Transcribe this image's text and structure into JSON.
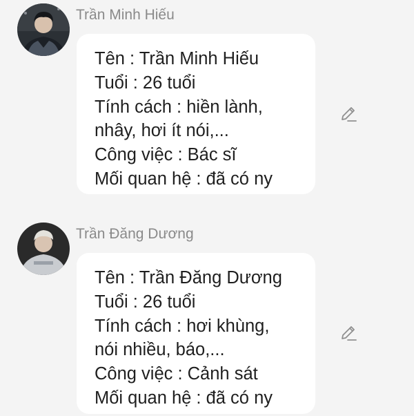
{
  "messages": [
    {
      "sender": "Trần Minh Hiếu",
      "avatar_icon": "profile-photo",
      "lines": [
        "Tên : Trần Minh Hiếu",
        "Tuổi : 26 tuổi",
        "Tính cách : hiền lành,",
        "nhây, hơi ít nói,...",
        "Công việc : Bác sĩ",
        "Mối quan hệ : đã có ny"
      ],
      "action_icon": "edit-icon"
    },
    {
      "sender": "Trần Đăng Dương",
      "avatar_icon": "profile-photo",
      "lines": [
        "Tên : Trần Đăng Dương",
        "Tuổi : 26 tuổi",
        "Tính cách : hơi khùng,",
        "nói nhiều, báo,...",
        "Công việc : Cảnh sát",
        "Mối quan hệ : đã có ny"
      ],
      "action_icon": "edit-icon"
    }
  ],
  "colors": {
    "background": "#f4f4f4",
    "bubble": "#ffffff",
    "text": "#1f1f1f",
    "sender": "#8a8a8a",
    "icon": "#8f8f8f"
  }
}
